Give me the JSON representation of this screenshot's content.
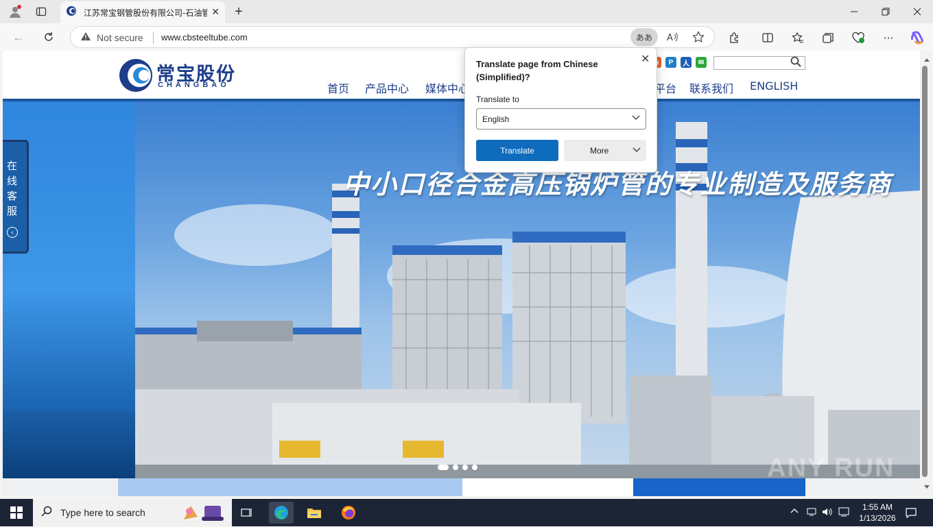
{
  "browser": {
    "tab_title": "江苏常宝钢管股份有限公司-石油管",
    "new_tab_glyph": "+",
    "security_label": "Not secure",
    "url": "www.cbsteeltube.com",
    "translate_pill_label": "ああ"
  },
  "site": {
    "logo_cn": "常宝股份",
    "logo_en": "CHANGBAO",
    "nav": [
      "首页",
      "产品中心",
      "媒体中心",
      "平台",
      "联系我们",
      "ENGLISH"
    ],
    "search_placeholder": "",
    "banner_slogan": "中小口径合金高压锅炉管的专业制造及服务商",
    "online_service": "在线客服"
  },
  "translate_popup": {
    "title": "Translate page from Chinese (Simplified)?",
    "to_label": "Translate to",
    "selected_language": "English",
    "translate_button": "Translate",
    "more_button": "More"
  },
  "watermark": "ANY RUN",
  "taskbar": {
    "search_placeholder": "Type here to search",
    "time": "1:55 AM",
    "date": "1/13/2026"
  },
  "colors": {
    "brand_blue": "#1d3e8a",
    "edge_accent": "#0f6cbd",
    "taskbar": "#1c2536"
  }
}
